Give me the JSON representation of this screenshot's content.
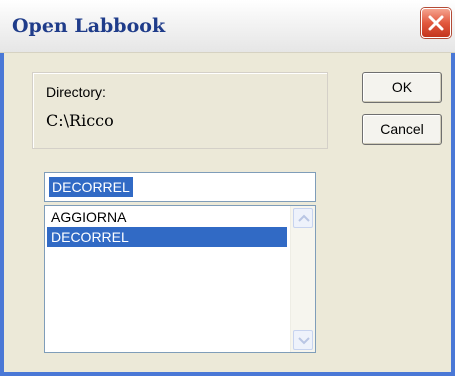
{
  "window": {
    "title": "Open Labbook",
    "close_icon": "close-icon"
  },
  "directory": {
    "label": "Directory:",
    "path": "C:\\Ricco"
  },
  "buttons": {
    "ok_label": "OK",
    "cancel_label": "Cancel"
  },
  "filename_input": {
    "value": "DECORREL"
  },
  "file_list": {
    "items": [
      {
        "label": "AGGIORNA",
        "selected": false
      },
      {
        "label": "DECORREL",
        "selected": true
      }
    ]
  },
  "colors": {
    "title_text": "#1f3c8a",
    "selection": "#316ac5",
    "dialog_bg": "#ece9d8",
    "close_button": "#e2583e"
  }
}
